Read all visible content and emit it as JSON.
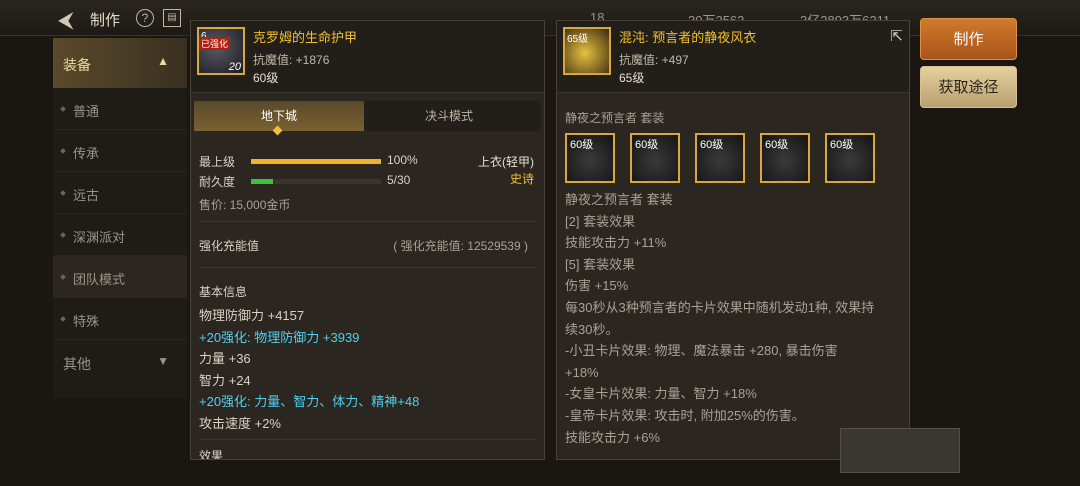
{
  "topbar": {
    "title": "制作",
    "help": "?",
    "cur1": "18",
    "cur2": "30万2563",
    "cur3": "3亿2893万6211"
  },
  "sidebar": {
    "category": "装备",
    "items": [
      {
        "label": "普通"
      },
      {
        "label": "传承"
      },
      {
        "label": "远古"
      },
      {
        "label": "深渊派对"
      },
      {
        "label": "团队模式"
      },
      {
        "label": "特殊"
      }
    ],
    "other": "其他"
  },
  "item1": {
    "name": "克罗姆的生命护甲",
    "stat": "抗魔值: +1876",
    "level": "60级",
    "icon_level": "20",
    "icon_tag": "已强化",
    "icon_top": "6",
    "tabs": [
      "地下城",
      "决斗模式"
    ],
    "max_label": "最上级",
    "max_value": "100%",
    "max_pct": 100,
    "dur_label": "耐久度",
    "dur_value": "5/30",
    "dur_pct": 17,
    "slot_type": "上衣(轻甲)",
    "rarity": "史诗",
    "price": "售价: 15,000金币",
    "charge_label": "强化充能值",
    "charge_value": "( 强化充能值: 12529539 )",
    "basic_title": "基本信息",
    "stats": [
      {
        "text": "物理防御力 +4157",
        "style": "normal"
      },
      {
        "text": "+20强化: 物理防御力 +3939",
        "style": "cyan"
      },
      {
        "text": "力量 +36",
        "style": "normal"
      },
      {
        "text": "智力 +24",
        "style": "normal"
      },
      {
        "text": "+20强化: 力量、智力、体力、精神+48",
        "style": "cyan"
      },
      {
        "text": "攻击速度 +2%",
        "style": "normal"
      }
    ],
    "effect_title": "效果"
  },
  "item2": {
    "name": "混沌: 预言者的静夜风衣",
    "stat": "抗魔值: +497",
    "level": "65级",
    "icon_level": "65级",
    "set_title": "静夜之预言者 套装",
    "slot_levels": [
      "60级",
      "60级",
      "60级",
      "60级",
      "60级"
    ],
    "lines": [
      {
        "text": "静夜之预言者 套装",
        "style": "grey"
      },
      {
        "text": "[2] 套装效果",
        "style": "grey"
      },
      {
        "text": "技能攻击力 +11%",
        "style": "grey"
      },
      {
        "text": "[5] 套装效果",
        "style": "grey"
      },
      {
        "text": "伤害 +15%",
        "style": "grey"
      },
      {
        "text": "每30秒从3种预言者的卡片效果中随机发动1种, 效果持",
        "style": "grey"
      },
      {
        "text": "续30秒。",
        "style": "grey"
      },
      {
        "text": "-小丑卡片效果: 物理、魔法暴击 +280, 暴击伤害",
        "style": "grey"
      },
      {
        "text": "+18%",
        "style": "grey"
      },
      {
        "text": "-女皇卡片效果: 力量、智力 +18%",
        "style": "grey"
      },
      {
        "text": "-皇帝卡片效果: 攻击时, 附加25%的伤害。",
        "style": "grey"
      },
      {
        "text": "技能攻击力 +6%",
        "style": "grey"
      }
    ]
  },
  "buttons": {
    "make": "制作",
    "get": "获取途径"
  }
}
